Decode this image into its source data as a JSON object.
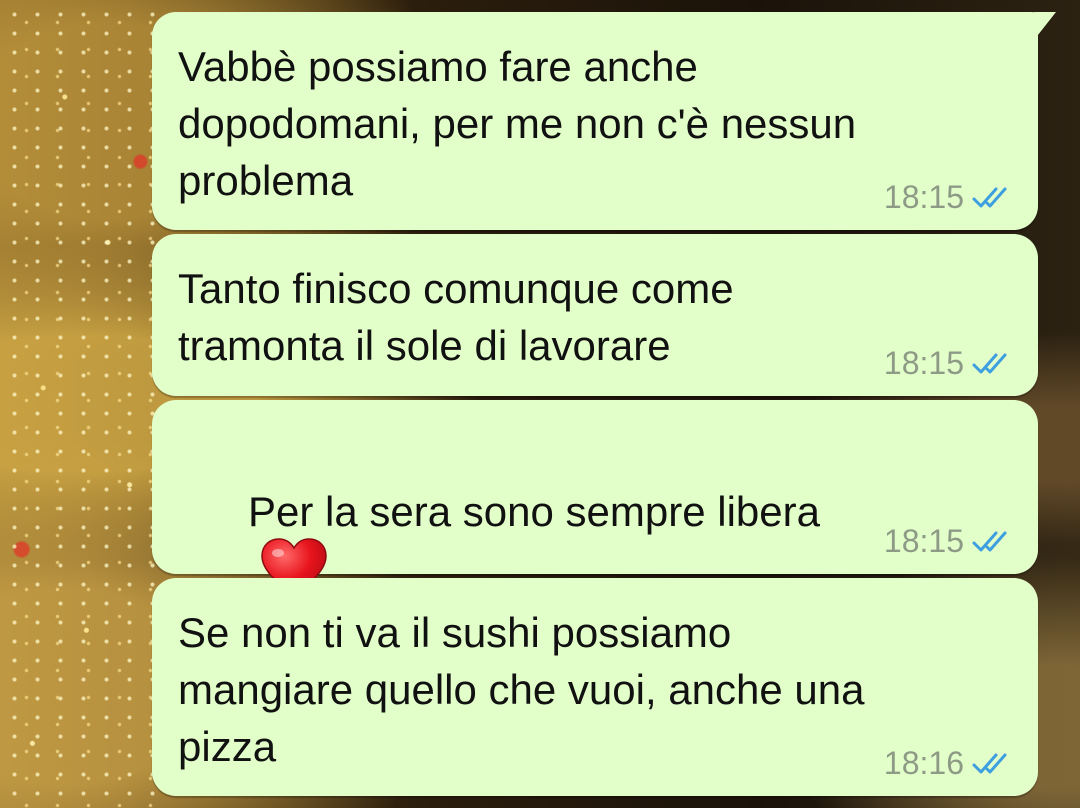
{
  "colors": {
    "bubble": "#e2ffc9",
    "text": "#111111",
    "time": "#8d9a86",
    "ticks": "#3d9fe0",
    "heart": "#e8141d"
  },
  "messages": [
    {
      "text": "Vabbè possiamo fare anche\ndopodomani, per me non c'è nessun\nproblema",
      "time": "18:15",
      "status_icon": "double-check-read-icon"
    },
    {
      "text": "Tanto finisco comunque come\ntramonta il sole di lavorare",
      "time": "18:15",
      "status_icon": "double-check-read-icon"
    },
    {
      "text": "Per la sera sono sempre libera",
      "emoji": "red-heart-icon",
      "time": "18:15",
      "status_icon": "double-check-read-icon"
    },
    {
      "text": "Se non ti va il sushi possiamo\nmangiare quello che vuoi, anche una\npizza",
      "time": "18:16",
      "status_icon": "double-check-read-icon"
    }
  ]
}
